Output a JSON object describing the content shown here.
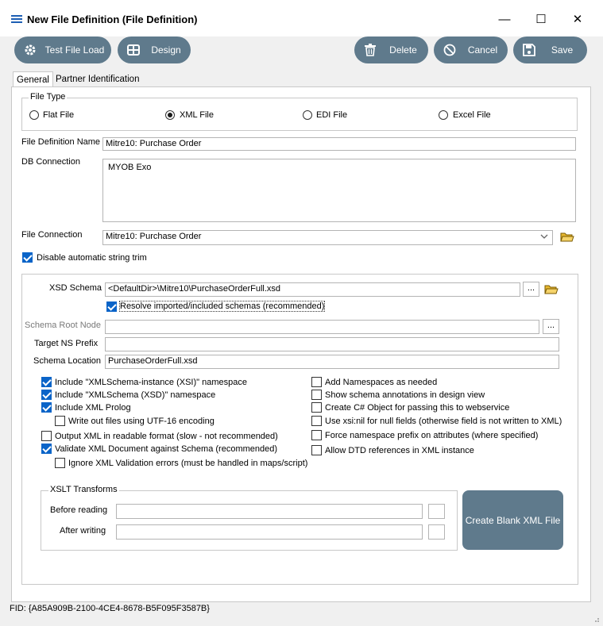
{
  "window": {
    "title": "New File Definition (File Definition)",
    "min_glyph": "—",
    "max_glyph": "☐",
    "close_glyph": "✕"
  },
  "toolbar": {
    "test_file_load": "Test File Load",
    "design": "Design",
    "delete": "Delete",
    "cancel": "Cancel",
    "save": "Save"
  },
  "tabs": [
    {
      "label": "General",
      "active": true
    },
    {
      "label": "Partner Identification",
      "active": false
    }
  ],
  "file_type": {
    "legend": "File Type",
    "options": [
      {
        "label": "Flat File",
        "selected": false
      },
      {
        "label": "XML File",
        "selected": true
      },
      {
        "label": "EDI File",
        "selected": false
      },
      {
        "label": "Excel File",
        "selected": false
      }
    ]
  },
  "fields": {
    "file_definition_name_label": "File Definition Name",
    "file_definition_name_value": "Mitre10: Purchase Order",
    "db_connection_label": "DB Connection",
    "db_connection_value": "MYOB Exo",
    "file_connection_label": "File Connection",
    "file_connection_value": "Mitre10: Purchase Order",
    "disable_trim_label": "Disable automatic string trim"
  },
  "xml": {
    "xsd_schema_label": "XSD Schema",
    "xsd_schema_value": "<DefaultDir>\\Mitre10\\PurchaseOrderFull.xsd",
    "resolve_label": "Resolve imported/included schemas (recommended)",
    "schema_root_node_label": "Schema Root Node",
    "schema_root_node_value": "",
    "target_ns_prefix_label": "Target NS Prefix",
    "target_ns_prefix_value": "",
    "schema_location_label": "Schema Location",
    "schema_location_value": "PurchaseOrderFull.xsd",
    "ellipsis": "..."
  },
  "options_left": [
    {
      "label": "Include \"XMLSchema-instance (XSI)\" namespace",
      "checked": true
    },
    {
      "label": "Include \"XMLSchema (XSD)\" namespace",
      "checked": true
    },
    {
      "label": "Include XML Prolog",
      "checked": true
    },
    {
      "label": "Write out files using UTF-16 encoding",
      "checked": false
    },
    {
      "label": "Output XML in readable format (slow - not recommended)",
      "checked": false
    },
    {
      "label": "Validate XML Document against Schema (recommended)",
      "checked": true
    },
    {
      "label": "Ignore XML Validation errors (must be handled in maps/script)",
      "checked": false
    }
  ],
  "options_right": [
    {
      "label": "Add Namespaces as needed",
      "checked": false
    },
    {
      "label": "Show schema annotations in design view",
      "checked": false
    },
    {
      "label": "Create C# Object for passing this to webservice",
      "checked": false
    },
    {
      "label": "Use xsi:nil for null fields (otherwise field is not written to XML)",
      "checked": false
    },
    {
      "label": "Force namespace prefix on attributes (where specified)",
      "checked": false
    },
    {
      "label": "Allow DTD references in XML instance",
      "checked": false
    }
  ],
  "xslt": {
    "legend": "XSLT Transforms",
    "before_reading_label": "Before reading",
    "before_reading_value": "",
    "after_writing_label": "After writing",
    "after_writing_value": "",
    "create_blank_xml": "Create Blank XML File"
  },
  "status": {
    "fid": "FID: {A85A909B-2100-4CE4-8678-B5F095F3587B}"
  },
  "colors": {
    "button_bg": "#5f7a8c",
    "check_blue": "#0a64c8",
    "title_icon": "#1e5fb4",
    "folder_yellow": "#e8b830"
  }
}
